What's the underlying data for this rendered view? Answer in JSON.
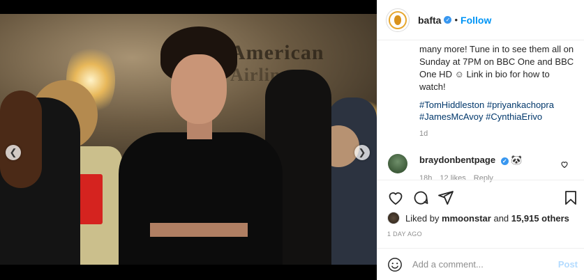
{
  "post": {
    "username": "bafta",
    "follow_label": "Follow",
    "separator": "•",
    "caption_text": "many more! Tune in to see them all on Sunday at 7PM on BBC One and BBC One HD ☺ Link in bio for how to watch!",
    "hashtags": [
      "#TomHiddleston",
      "#priyankachopra",
      "#JamesMcAvoy",
      "#CynthiaErivo"
    ],
    "caption_age": "1d",
    "photo_sign": [
      "American",
      "Airlin"
    ]
  },
  "comment": {
    "username": "braydonbentpage",
    "emoji": "🐼",
    "age": "18h",
    "likes": "12 likes",
    "reply": "Reply"
  },
  "likes": {
    "prefix": "Liked by",
    "user": "mmoonstar",
    "conj": "and",
    "others": "15,915 others"
  },
  "posted": "1 DAY AGO",
  "comment_box": {
    "placeholder": "Add a comment...",
    "post_label": "Post"
  },
  "carousel": {
    "prev_icon": "chevron-left-icon",
    "next_icon": "chevron-right-icon",
    "dot_count": 4,
    "active_dot": 1
  },
  "colors": {
    "accent": "#0095f6",
    "link": "#00376b",
    "muted": "#8e8e8e"
  }
}
